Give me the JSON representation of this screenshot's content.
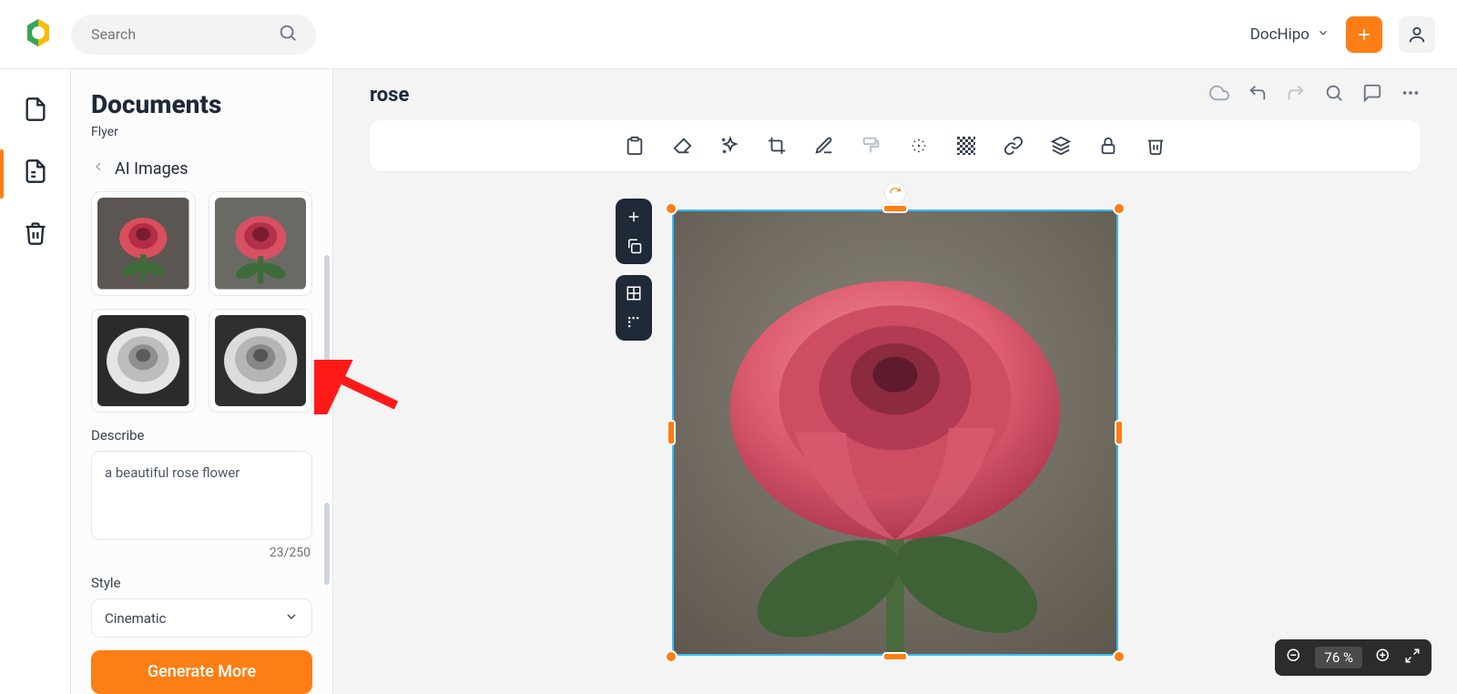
{
  "topbar": {
    "search_placeholder": "Search",
    "brand_label": "DocHipo"
  },
  "side": {
    "title": "Documents",
    "subtitle": "Flyer",
    "crumb": "AI Images",
    "describe_label": "Describe",
    "describe_value": "a beautiful rose flower",
    "counter": "23/250",
    "style_label": "Style",
    "style_value": "Cinematic",
    "generate_label": "Generate More"
  },
  "doc": {
    "title": "rose"
  },
  "zoom": {
    "value": "76 %"
  },
  "icons": {
    "plus": "+"
  }
}
